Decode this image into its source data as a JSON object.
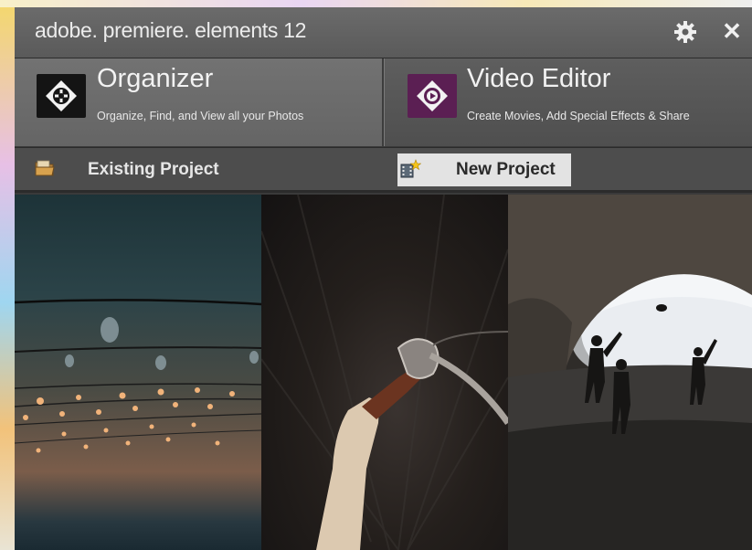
{
  "app": {
    "title": "adobe. premiere. elements 12",
    "settings_icon": "gear-icon",
    "close_label": "✕"
  },
  "modes": [
    {
      "id": "organizer",
      "title": "Organizer",
      "subtitle": "Organize, Find, and View all your Photos",
      "icon": "organizer-logo-icon",
      "color": "#141414"
    },
    {
      "id": "video-editor",
      "title": "Video Editor",
      "subtitle": "Create Movies, Add Special Effects & Share",
      "icon": "video-editor-logo-icon",
      "color": "#5b1f53"
    }
  ],
  "actions": {
    "existing": {
      "label": "Existing Project",
      "icon": "folder-icon"
    },
    "new": {
      "label": "New Project",
      "icon": "new-project-icon"
    }
  },
  "photos": [
    {
      "id": "string-lights"
    },
    {
      "id": "bicycle-handlebar"
    },
    {
      "id": "sea-cave-silhouettes"
    }
  ]
}
